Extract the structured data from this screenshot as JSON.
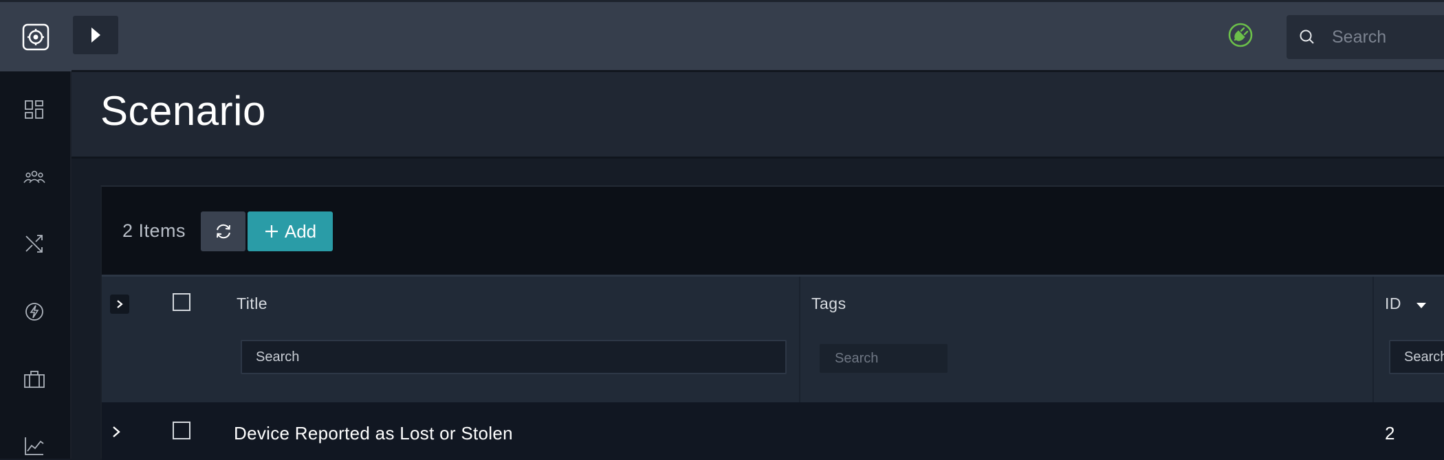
{
  "app": {
    "page_title": "Scenario"
  },
  "sidebar": {
    "items": [
      {
        "icon": "dashboard-icon"
      },
      {
        "icon": "users-icon"
      },
      {
        "icon": "shuffle-icon"
      },
      {
        "icon": "bolt-icon"
      },
      {
        "icon": "briefcase-icon"
      },
      {
        "icon": "chart-icon"
      }
    ]
  },
  "topbar": {
    "search_placeholder": "Search",
    "status_icon": "plug-icon",
    "status_color": "#6cc04a"
  },
  "toolbar": {
    "item_count": "2 Items",
    "add_label": "Add"
  },
  "table": {
    "columns": [
      "Title",
      "Tags",
      "ID"
    ],
    "filter_placeholders": {
      "title": "Search",
      "tags": "Search",
      "id": "Search"
    },
    "rows": [
      {
        "title": "Device Reported as Lost or Stolen",
        "id": "2"
      }
    ]
  },
  "colors": {
    "accent": "#2a9ca7",
    "sidebar": "#0f141c",
    "topbar": "#363e4c"
  }
}
